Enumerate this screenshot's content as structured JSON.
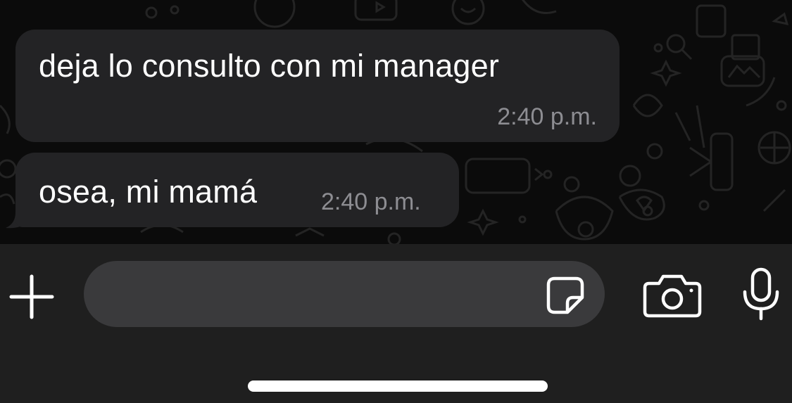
{
  "chat": {
    "messages": [
      {
        "text": "deja lo consulto con mi manager",
        "time": "2:40 p.m."
      },
      {
        "text": "osea, mi mamá",
        "time": "2:40 p.m."
      }
    ]
  },
  "composer": {
    "placeholder": "",
    "value": "",
    "icons": {
      "attach": "plus-icon",
      "sticker": "sticker-icon",
      "camera": "camera-icon",
      "microphone": "microphone-icon"
    }
  },
  "colors": {
    "chat_background": "#0b0b0b",
    "bubble": "#232325",
    "message_text": "#ffffff",
    "timestamp": "#8d8d92",
    "input_bar": "#1f1f1f",
    "text_field": "#3a3a3c"
  }
}
